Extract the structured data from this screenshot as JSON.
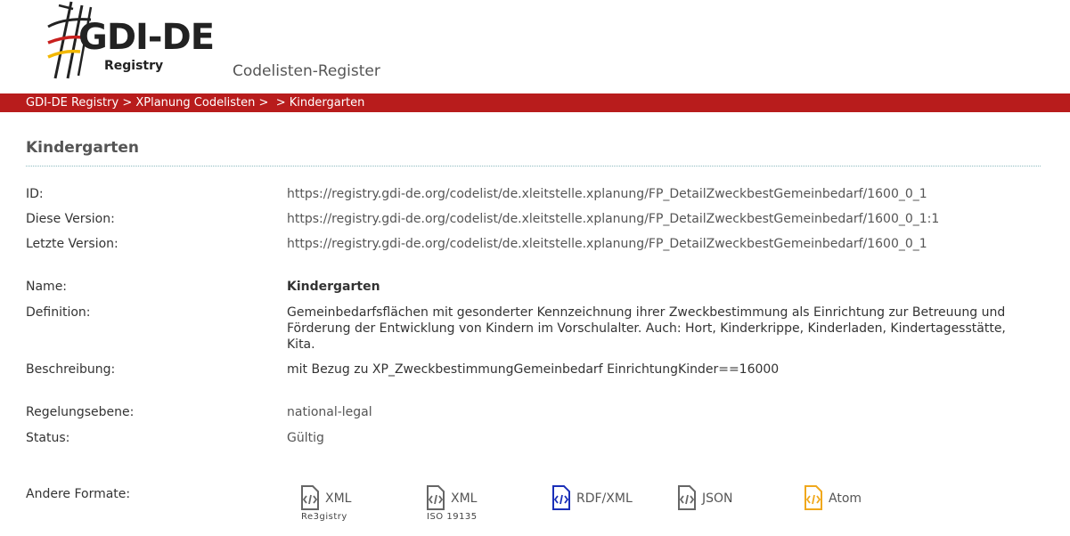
{
  "header": {
    "logo_text": "GDI-DE",
    "logo_subtext": "Registry",
    "subtitle": "Codelisten-Register"
  },
  "breadcrumb": [
    {
      "label": "GDI-DE Registry"
    },
    {
      "label": "XPlanung Codelisten"
    },
    {
      "label": ""
    },
    {
      "label": "Kindergarten"
    }
  ],
  "breadcrumb_separator": " > ",
  "page": {
    "title": "Kindergarten"
  },
  "details": {
    "id_label": "ID:",
    "id_value": "https://registry.gdi-de.org/codelist/de.xleitstelle.xplanung/FP_DetailZweckbestGemeinbedarf/1600_0_1",
    "this_version_label": "Diese Version:",
    "this_version_value": "https://registry.gdi-de.org/codelist/de.xleitstelle.xplanung/FP_DetailZweckbestGemeinbedarf/1600_0_1:1",
    "latest_version_label": "Letzte Version:",
    "latest_version_value": "https://registry.gdi-de.org/codelist/de.xleitstelle.xplanung/FP_DetailZweckbestGemeinbedarf/1600_0_1",
    "name_label": "Name:",
    "name_value": "Kindergarten",
    "definition_label": "Definition:",
    "definition_value": "Gemeinbedarfsflächen mit gesonderter Kennzeichnung ihrer Zweckbestimmung als Einrichtung zur Betreuung und Förderung der Entwicklung von Kindern im Vorschulalter. Auch: Hort, Kinderkrippe, Kinderladen, Kindertagesstätte, Kita.",
    "description_label": "Beschreibung:",
    "description_value": "mit Bezug zu XP_ZweckbestimmungGemeinbedarf EinrichtungKinder==16000",
    "level_label": "Regelungsebene:",
    "level_value": "national-legal",
    "status_label": "Status:",
    "status_value": "Gültig"
  },
  "formats": {
    "label": "Andere Formate:",
    "items": [
      {
        "label": "XML",
        "sublabel": "Re3gistry",
        "color": "#666666",
        "icon": "code-file-icon"
      },
      {
        "label": "XML",
        "sublabel": "ISO 19135",
        "color": "#666666",
        "icon": "code-file-icon"
      },
      {
        "label": "RDF/XML",
        "sublabel": "",
        "color": "#1a2fb8",
        "icon": "code-file-icon"
      },
      {
        "label": "JSON",
        "sublabel": "",
        "color": "#666666",
        "icon": "code-file-icon"
      },
      {
        "label": "Atom",
        "sublabel": "",
        "color": "#f0a81c",
        "icon": "code-file-icon"
      }
    ]
  },
  "colors": {
    "brand_red": "#b81c1c",
    "divider": "#8cb9bf",
    "logo_red": "#c8201e",
    "logo_gold": "#f2b700",
    "logo_black": "#222222"
  }
}
